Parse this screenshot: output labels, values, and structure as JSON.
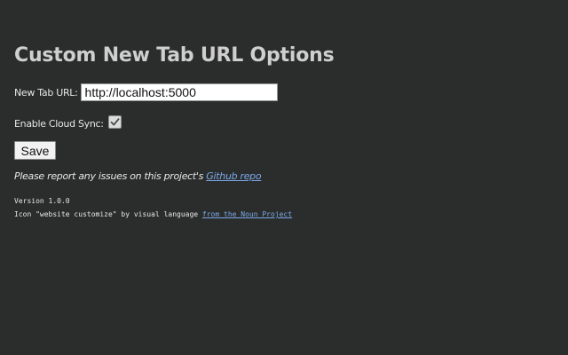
{
  "page": {
    "title": "Custom New Tab URL Options"
  },
  "url_field": {
    "label": "New Tab URL:",
    "value": "http://localhost:5000"
  },
  "cloud_sync": {
    "label": "Enable Cloud Sync:",
    "checked": true,
    "icon": "checkmark-icon"
  },
  "actions": {
    "save_label": "Save"
  },
  "report": {
    "prefix": "Please report any issues on this project's ",
    "link_text": "Github repo"
  },
  "footer": {
    "version": "Version 1.0.0",
    "credit_prefix": "Icon \"website customize\" by visual language ",
    "credit_link": "from the Noun Project"
  },
  "colors": {
    "background": "#2b2d2c",
    "link": "#7aa8e8",
    "title": "#cfcfcf"
  }
}
